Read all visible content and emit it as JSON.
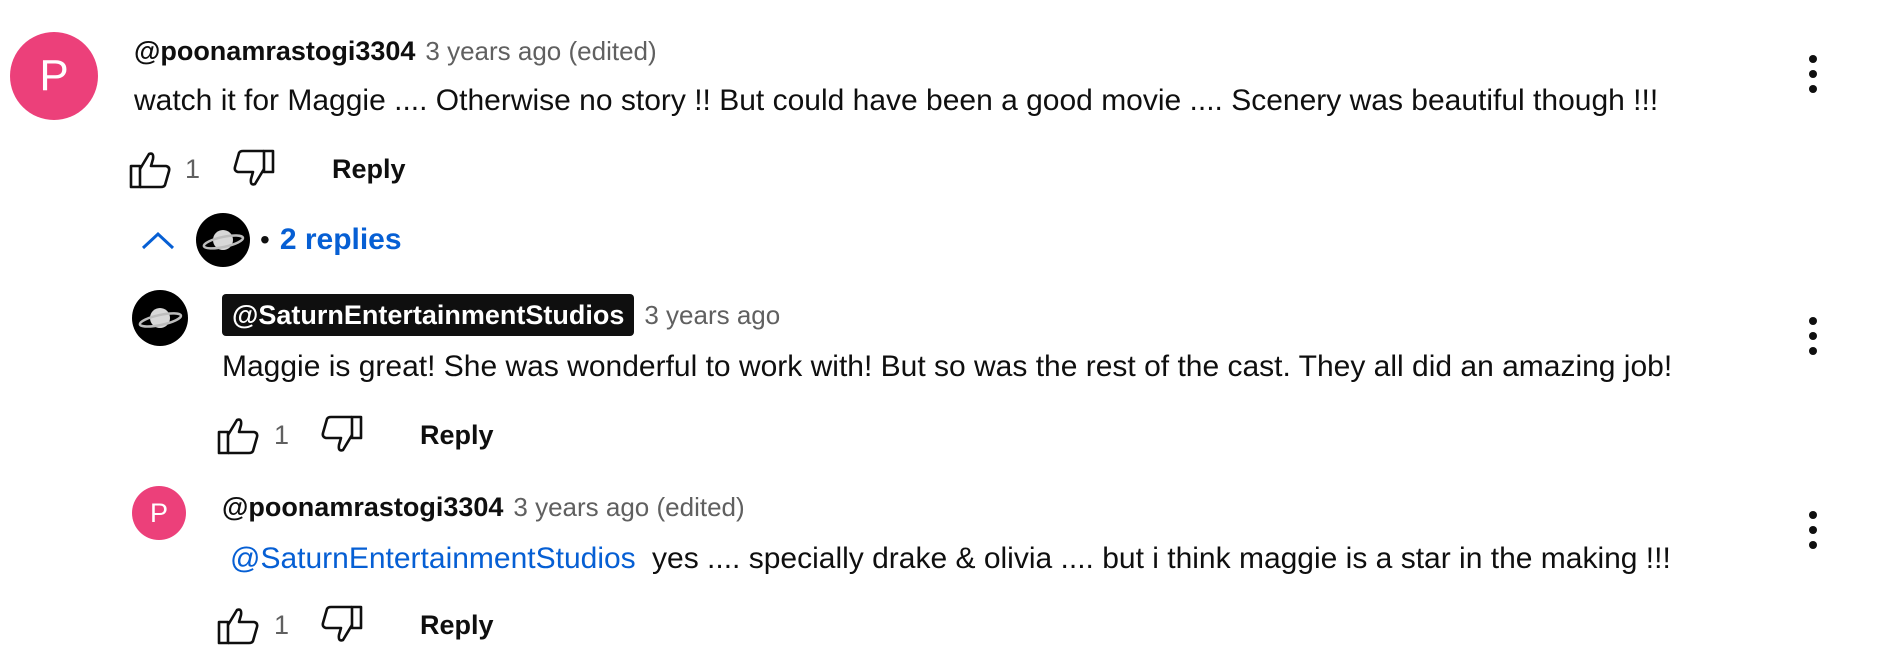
{
  "colors": {
    "avatar_pink": "#ec407a",
    "link_blue": "#065fd4",
    "meta_gray": "#606060"
  },
  "comments": [
    {
      "avatar_letter": "P",
      "author": "@poonamrastogi3304",
      "meta": "3 years ago (edited)",
      "text": "watch it for Maggie .... Otherwise no story !! But could have been a good movie .... Scenery was beautiful though !!!",
      "likes": "1",
      "reply_label": "Reply"
    }
  ],
  "replies_toggle": {
    "label": "2 replies",
    "icon": "chevron-up-icon"
  },
  "replies": [
    {
      "author": "@SaturnEntertainmentStudios",
      "meta": "3 years ago",
      "text": "Maggie is great!  She was wonderful to work with!  But so was the rest of the cast.  They all did an amazing job!",
      "likes": "1",
      "reply_label": "Reply"
    },
    {
      "avatar_letter": "P",
      "author": "@poonamrastogi3304",
      "meta": "3 years ago (edited)",
      "mention": "@SaturnEntertainmentStudios",
      "text": "yes .... specially drake & olivia .... but i think maggie is a star in the making !!!",
      "likes": "1",
      "reply_label": "Reply"
    }
  ]
}
